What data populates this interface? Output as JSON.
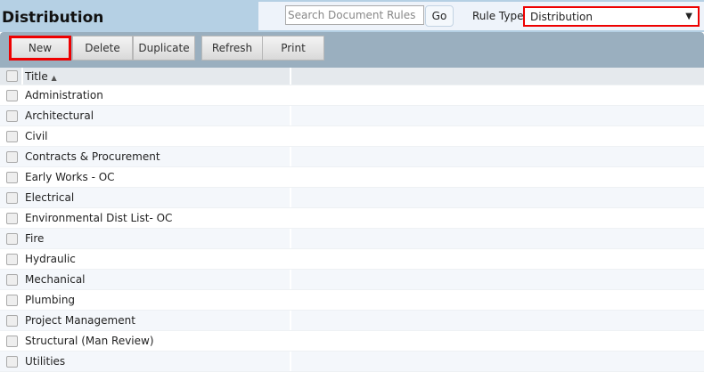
{
  "header": {
    "title": "Distribution",
    "search_placeholder": "Search Document Rules",
    "go_label": "Go",
    "rule_type_label": "Rule Type:",
    "rule_type_value": "Distribution"
  },
  "toolbar": {
    "new": "New",
    "delete": "Delete",
    "duplicate": "Duplicate",
    "refresh": "Refresh",
    "print": "Print"
  },
  "grid": {
    "column_title": "Title",
    "sort_icon": "▲",
    "rows": [
      "Administration",
      "Architectural",
      "Civil",
      "Contracts & Procurement",
      "Early Works - OC",
      "Electrical",
      "Environmental Dist List- OC",
      "Fire",
      "Hydraulic",
      "Mechanical",
      "Plumbing",
      "Project Management",
      "Structural (Man Review)",
      "Utilities"
    ]
  }
}
